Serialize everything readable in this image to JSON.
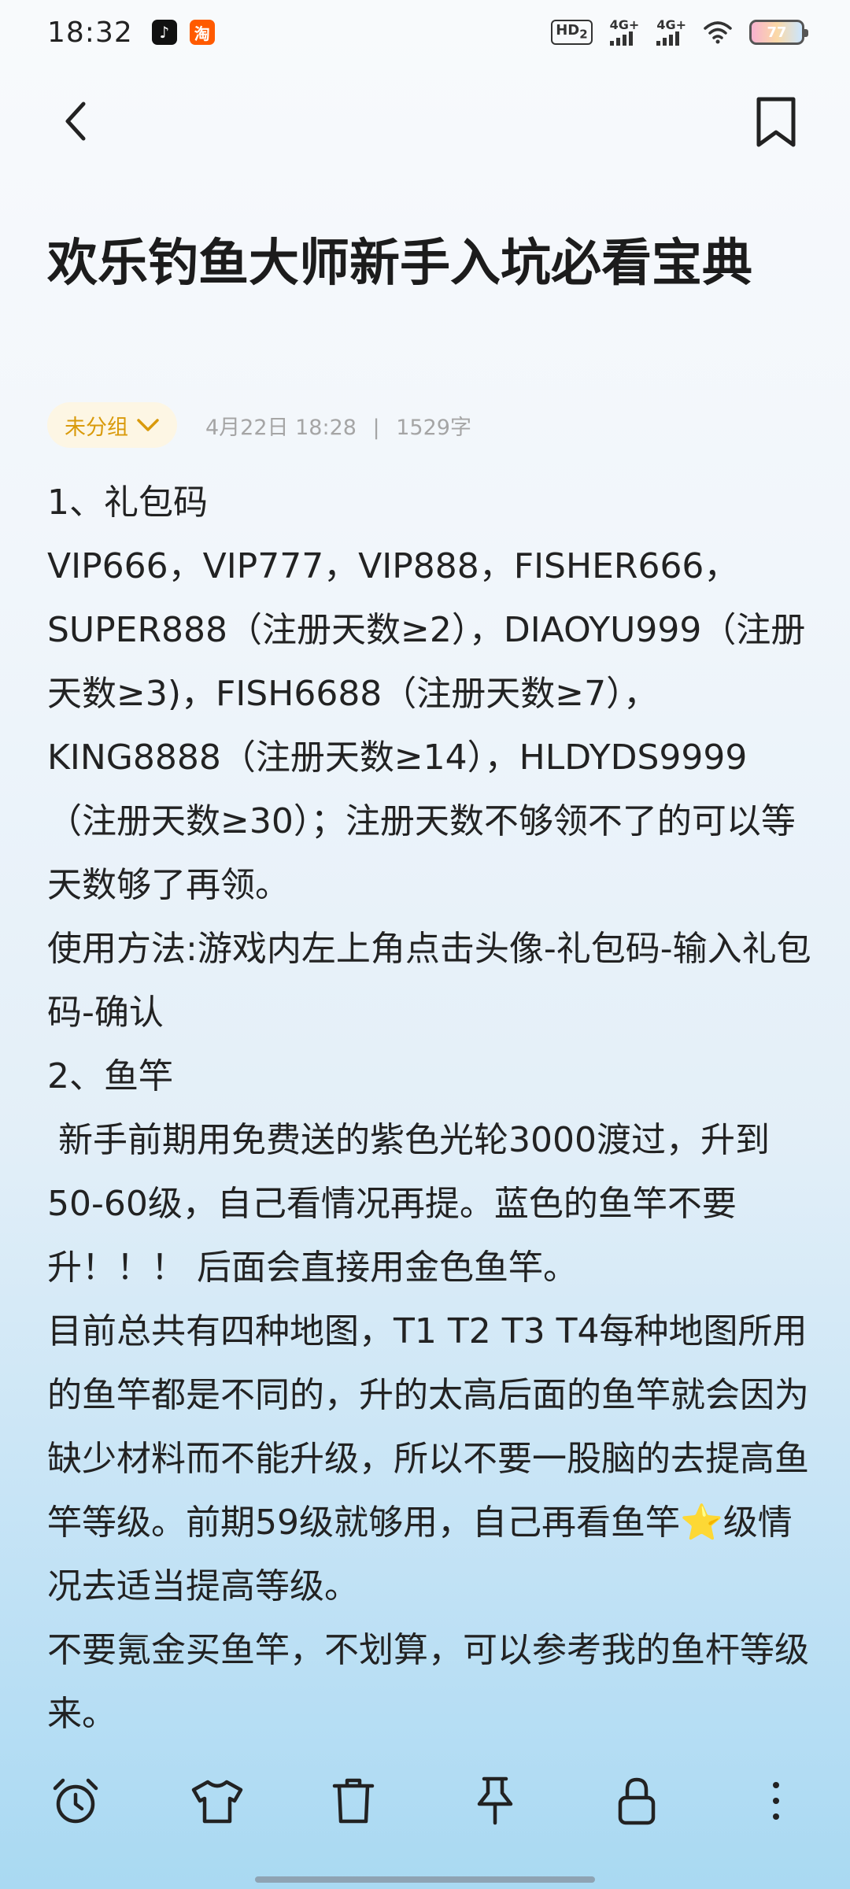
{
  "status_bar": {
    "time": "18:32",
    "app_icons": [
      "tiktok-icon",
      "taobao-icon"
    ],
    "hd_label": "HD",
    "hd_sub": "2",
    "net1_label": "4G+",
    "net2_label": "4G+",
    "battery": "77"
  },
  "nav": {
    "back_icon": "chevron-left-icon",
    "bookmark_icon": "bookmark-icon"
  },
  "note": {
    "title": "欢乐钓鱼大师新手入坑必看宝典",
    "group": "未分组",
    "date": "4月22日 18:28",
    "separator": "|",
    "word_count": "1529字",
    "paragraphs": [
      "1、礼包码",
      "VIP666，VIP777，VIP888，FISHER666，SUPER888（注册天数≥2），DIAOYU999（注册天数≥3)，FISH6688（注册天数≥7），KING8888（注册天数≥14），HLDYDS9999（注册天数≥30）；注册天数不够领不了的可以等天数够了再领。",
      "使用方法:游戏内左上角点击头像-礼包码-输入礼包码-确认",
      "2、鱼竿",
      " 新手前期用免费送的紫色光轮3000渡过，升到50-60级，自己看情况再提。蓝色的鱼竿不要升！！！ 后面会直接用金色鱼竿。",
      "目前总共有四种地图，T1 T2 T3 T4每种地图所用的鱼竿都是不同的，升的太高后面的鱼竿就会因为缺少材料而不能升级，所以不要一股脑的去提高鱼竿等级。前期59级就够用，自己再看鱼竿⭐级情况去适当提高等级。",
      "不要氪金买鱼竿，不划算，可以参考我的鱼杆等级来。"
    ]
  },
  "toolbar": {
    "items": [
      "alarm-clock-icon",
      "shirt-icon",
      "trash-icon",
      "pin-icon",
      "lock-icon",
      "more-vertical-icon"
    ]
  },
  "colors": {
    "accent": "#d99a0b",
    "chip_bg": "#fdf6e4",
    "meta_text": "#a5a5a5",
    "text": "#222222"
  }
}
